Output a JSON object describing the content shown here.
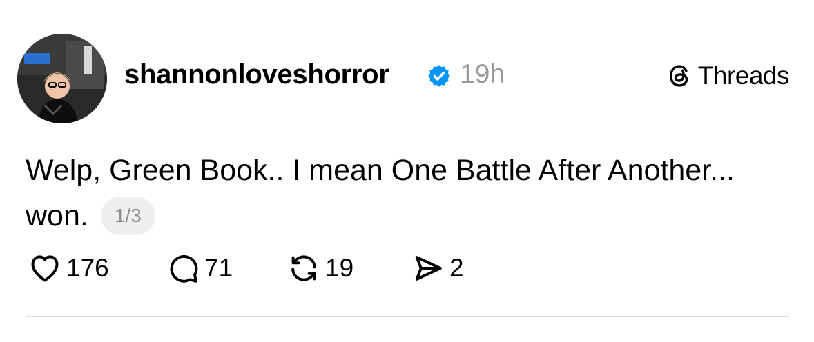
{
  "post": {
    "username": "shannonloveshorror",
    "verified": true,
    "timestamp": "19h",
    "brand": "Threads",
    "text_line1": "Welp, Green Book.. I mean One Battle After Another...",
    "text_line2": "won.",
    "page_indicator": "1/3"
  },
  "actions": {
    "likes": "176",
    "replies": "71",
    "reposts": "19",
    "shares": "2"
  },
  "icons": {
    "verified": "verified-badge-icon",
    "brand": "threads-logo-icon",
    "like": "heart-icon",
    "reply": "speech-bubble-icon",
    "repost": "repost-arrows-icon",
    "share": "send-icon"
  },
  "colors": {
    "verified": "#0095f6",
    "muted": "#999999",
    "pill_bg": "#efefef",
    "divider": "#dbdbdb"
  }
}
